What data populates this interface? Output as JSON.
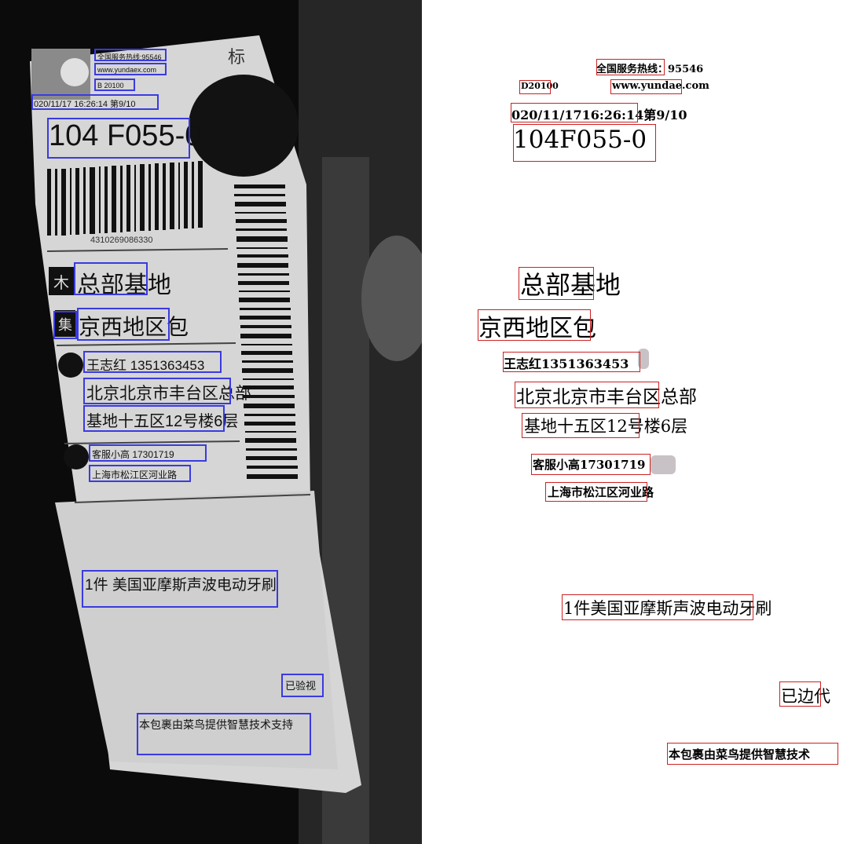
{
  "photo": {
    "hotline": "全国服务热线:95546",
    "website": "www.yundaex.com",
    "code": "B 20100",
    "datetime": "020/11/17 16:26:14 第9/10",
    "route_code": "104 F055-0",
    "barcode_number": "4310269086330",
    "hub": "总部基地",
    "badge_1": "木",
    "destination": "京西地区包",
    "badge_2": "集",
    "recipient": "王志红 1351363453",
    "address_line1": "北京北京市丰台区总部",
    "address_line2": "基地十五区12号楼6层",
    "sender": "客服小高 17301719",
    "sender_address": "上海市松江区河业路",
    "item": "1件 美国亚摩斯声波电动牙刷",
    "verified": "已验视",
    "footer": "本包裹由菜鸟提供智慧技术支持",
    "side_label": "标"
  },
  "render": {
    "hotline": "全国服务热线：95546",
    "code": "D20100",
    "website": "www.yundae.com",
    "datetime": "020/11/1716:26:14第9/10",
    "route_code": "104F055-0",
    "hub": "总部基地",
    "destination": "京西地区包",
    "recipient": "王志红1351363453",
    "address_line1": "北京北京市丰台区总部",
    "address_line2": "基地十五区12号楼6层",
    "sender": "客服小高17301719",
    "sender_address": "上海市松江区河业路",
    "item": "1件美国亚摩斯声波电动牙刷",
    "verified": "已边代",
    "footer": "本包裹由菜鸟提供智慧技术"
  },
  "colors": {
    "detection_box_photo": "#3a3ae0",
    "detection_box_render": "#cc2222",
    "photo_background": "#0a0a0a",
    "label_paper": "#d9d9d9"
  }
}
